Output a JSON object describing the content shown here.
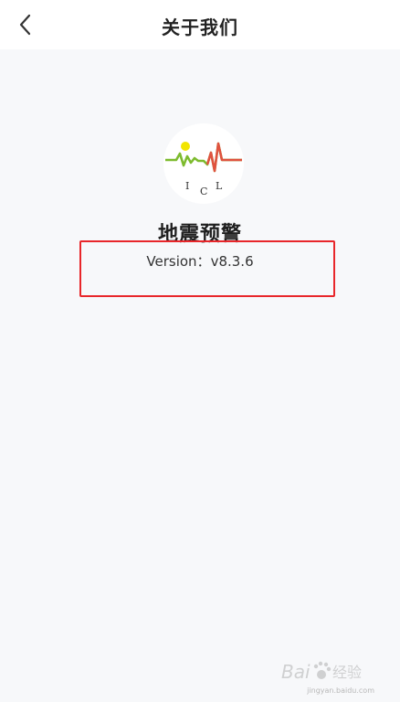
{
  "header": {
    "title": "关于我们",
    "back_icon": "chevron-left-icon"
  },
  "app": {
    "logo_letters": [
      "I",
      "C",
      "L"
    ],
    "name": "地震预警",
    "version_label": "Version：",
    "version_value": "v8.3.6"
  },
  "annotation": {
    "highlight_color": "#e8262a"
  },
  "watermark": {
    "brand": "Bai",
    "product": "经验",
    "url": "jingyan.baidu.com"
  },
  "colors": {
    "logo_green": "#7dbb2e",
    "logo_yellow": "#f2e500",
    "logo_red": "#e0523f"
  }
}
